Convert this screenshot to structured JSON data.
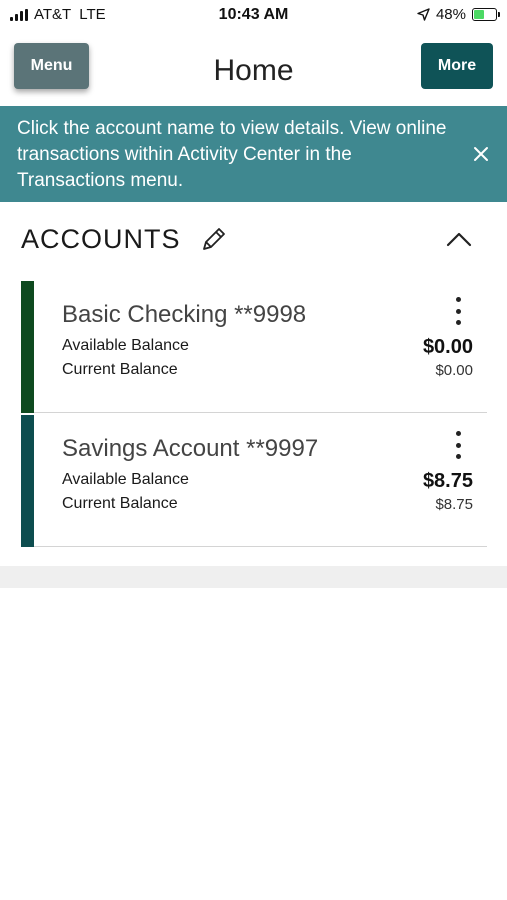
{
  "status_bar": {
    "carrier": "AT&T",
    "network": "LTE",
    "time": "10:43 AM",
    "battery_percent": "48%",
    "battery_level": 0.48,
    "battery_color": "#4cd964"
  },
  "header": {
    "menu_label": "Menu",
    "title": "Home",
    "more_label": "More"
  },
  "banner": {
    "text": "Click the account name to view details. View online transactions within Activity Center in the Transactions menu.",
    "background": "#3f8890",
    "close_icon": "close-icon"
  },
  "accounts": {
    "title": "ACCOUNTS",
    "edit_icon": "pencil-icon",
    "collapse_icon": "chevron-up-icon",
    "items": [
      {
        "name": "Basic Checking **9998",
        "available_label": "Available Balance",
        "available_value": "$0.00",
        "current_label": "Current Balance",
        "current_value": "$0.00",
        "accent_color": "#0e4a1f"
      },
      {
        "name": "Savings Account **9997",
        "available_label": "Available Balance",
        "available_value": "$8.75",
        "current_label": "Current Balance",
        "current_value": "$8.75",
        "accent_color": "#0d4d4f"
      }
    ]
  }
}
